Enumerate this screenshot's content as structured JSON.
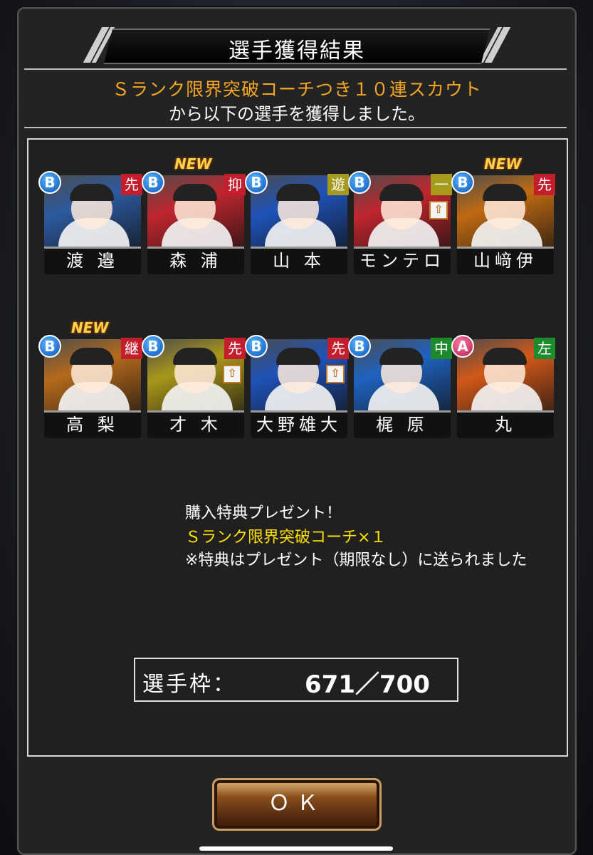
{
  "title": "選手獲得結果",
  "message": {
    "line1": "Ｓランク限界突破コーチつき１０連スカウト",
    "line2": "から以下の選手を獲得しました。"
  },
  "players": [
    {
      "name": "渡 邉",
      "rank": "B",
      "position": "先",
      "pos_color": "red",
      "is_new": false,
      "has_up": false,
      "bg": "#2c5aa0"
    },
    {
      "name": "森 浦",
      "rank": "B",
      "position": "抑",
      "pos_color": "red",
      "is_new": true,
      "has_up": false,
      "bg": "#c0262e"
    },
    {
      "name": "山 本",
      "rank": "B",
      "position": "遊",
      "pos_color": "yellow",
      "is_new": false,
      "has_up": false,
      "bg": "#1f52b8"
    },
    {
      "name": "モンテロ",
      "rank": "B",
      "position": "一",
      "pos_color": "yellow",
      "is_new": false,
      "has_up": true,
      "bg": "#c0262e"
    },
    {
      "name": "山﨑伊",
      "rank": "B",
      "position": "先",
      "pos_color": "red",
      "is_new": true,
      "has_up": false,
      "bg": "#c06a12"
    },
    {
      "name": "高 梨",
      "rank": "B",
      "position": "継",
      "pos_color": "red",
      "is_new": true,
      "has_up": false,
      "bg": "#b56a1c"
    },
    {
      "name": "才 木",
      "rank": "B",
      "position": "先",
      "pos_color": "red",
      "is_new": false,
      "has_up": true,
      "bg": "#a8961a"
    },
    {
      "name": "大野雄大",
      "rank": "B",
      "position": "先",
      "pos_color": "red",
      "is_new": false,
      "has_up": true,
      "bg": "#1f52b8"
    },
    {
      "name": "梶 原",
      "rank": "B",
      "position": "中",
      "pos_color": "green",
      "is_new": false,
      "has_up": false,
      "bg": "#1f62c0"
    },
    {
      "name": "丸",
      "rank": "A",
      "position": "左",
      "pos_color": "green",
      "is_new": false,
      "has_up": false,
      "bg": "#d2581a"
    }
  ],
  "new_label": "NEW",
  "up_icon": "up-arrow-icon",
  "bonus": {
    "line1": "購入特典プレゼント！",
    "line2": "Ｓランク限界突破コーチ×１",
    "line3": "※特典はプレゼント（期限なし）に送られました"
  },
  "slots": {
    "label": "選手枠：",
    "value": "671／700"
  },
  "ok_label": "ＯＫ"
}
